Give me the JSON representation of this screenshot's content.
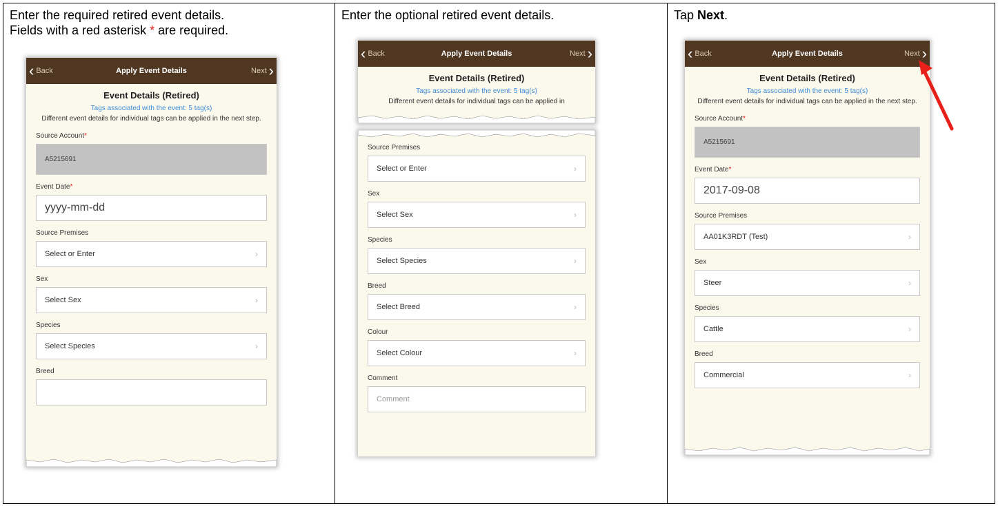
{
  "col1": {
    "instr_line1": "Enter the required retired event details.",
    "instr_line2_a": "Fields with a red asterisk ",
    "instr_asterisk": "*",
    "instr_line2_b": " are required.",
    "phone": {
      "nav": {
        "back": "Back",
        "title": "Apply Event Details",
        "next": "Next"
      },
      "heading": "Event Details (Retired)",
      "tags": "Tags associated with the event: 5 tag(s)",
      "note": "Different event details for individual tags can be applied in the next step.",
      "fields": {
        "source_account_label": "Source Account",
        "source_account_value": "A5215691",
        "event_date_label": "Event Date",
        "event_date_placeholder": "yyyy-mm-dd",
        "source_premises_label": "Source Premises",
        "source_premises_value": "Select or Enter",
        "sex_label": "Sex",
        "sex_value": "Select Sex",
        "species_label": "Species",
        "species_value": "Select Species",
        "breed_label": "Breed"
      }
    }
  },
  "col2": {
    "instr": "Enter the optional retired event details.",
    "phone": {
      "nav": {
        "back": "Back",
        "title": "Apply Event Details",
        "next": "Next"
      },
      "heading": "Event Details (Retired)",
      "tags": "Tags associated with the event: 5 tag(s)",
      "note": "Different event details for individual tags can be applied in",
      "fields": {
        "source_premises_label": "Source Premises",
        "source_premises_value": "Select or Enter",
        "sex_label": "Sex",
        "sex_value": "Select Sex",
        "species_label": "Species",
        "species_value": "Select Species",
        "breed_label": "Breed",
        "breed_value": "Select Breed",
        "colour_label": "Colour",
        "colour_value": "Select Colour",
        "comment_label": "Comment",
        "comment_placeholder": "Comment"
      }
    }
  },
  "col3": {
    "instr_a": "Tap ",
    "instr_bold": "Next",
    "instr_b": ".",
    "phone": {
      "nav": {
        "back": "Back",
        "title": "Apply Event Details",
        "next": "Next"
      },
      "heading": "Event Details (Retired)",
      "tags": "Tags associated with the event: 5 tag(s)",
      "note": "Different event details for individual tags can be applied in the next step.",
      "fields": {
        "source_account_label": "Source Account",
        "source_account_value": "A5215691",
        "event_date_label": "Event Date",
        "event_date_value": "2017-09-08",
        "source_premises_label": "Source Premises",
        "source_premises_value": "AA01K3RDT (Test)",
        "sex_label": "Sex",
        "sex_value": "Steer",
        "species_label": "Species",
        "species_value": "Cattle",
        "breed_label": "Breed",
        "breed_value": "Commercial"
      }
    }
  },
  "colors": {
    "nav_brown": "#4f3722",
    "app_bg": "#fbf8ec",
    "tag_blue": "#3e8cd8",
    "required_red": "#e02020",
    "arrow_red": "#e8201a"
  }
}
